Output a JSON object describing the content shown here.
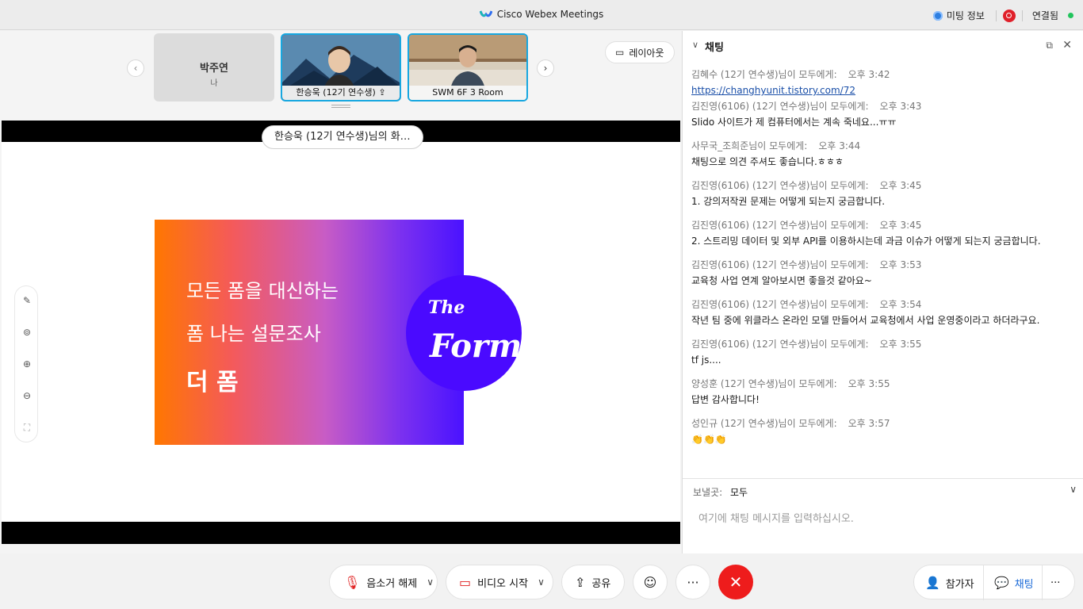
{
  "window": {
    "title": "Cisco Webex Meetings",
    "meeting_info": "미팅 정보",
    "connected": "연결됨"
  },
  "filmstrip": {
    "self_name": "박주연",
    "self_tag": "나",
    "participants": [
      {
        "label": "한승욱 (12기 연수생)"
      },
      {
        "label": "SWM 6F 3 Room"
      }
    ],
    "layout_label": "레이아웃"
  },
  "stage": {
    "share_label": "한승욱 (12기 연수생)님의 화…",
    "slide_line1": "모든 폼을 대신하는",
    "slide_line2": "폼 나는 설문조사",
    "slide_line3": "더 폼",
    "logo_the": "The",
    "logo_form": "Form"
  },
  "chat": {
    "title": "채팅",
    "messages": [
      {
        "from": "김혜수 (12기 연수생)님이 모두에게:",
        "time": "오후 3:42",
        "text": "https://changhyunit.tistory.com/72",
        "link": true
      },
      {
        "from": "김진영(6106) (12기 연수생)님이 모두에게:",
        "time": "오후 3:43",
        "text": "Slido 사이트가 제 컴퓨터에서는 계속 죽네요...ㅠㅠ"
      },
      {
        "from": "사무국_조희준님이 모두에게:",
        "time": "오후 3:44",
        "text": "채팅으로 의견 주셔도 좋습니다.ㅎㅎㅎ"
      },
      {
        "from": "김진영(6106) (12기 연수생)님이 모두에게:",
        "time": "오후 3:45",
        "text": "1. 강의저작권 문제는 어떻게 되는지 궁금합니다."
      },
      {
        "from": "김진영(6106) (12기 연수생)님이 모두에게:",
        "time": "오후 3:45",
        "text": "2. 스트리밍 데이터 및 외부 API를 이용하시는데 과금 이슈가 어떻게 되는지 궁금합니다."
      },
      {
        "from": "김진영(6106) (12기 연수생)님이 모두에게:",
        "time": "오후 3:53",
        "text": "교육청 사업 연계 알아보시면 좋을것 같아요~"
      },
      {
        "from": "김진영(6106) (12기 연수생)님이 모두에게:",
        "time": "오후 3:54",
        "text": "작년 팀 중에 위클라스 온라인 모델 만들어서 교육청에서 사업 운영중이라고 하더라구요."
      },
      {
        "from": "김진영(6106) (12기 연수생)님이 모두에게:",
        "time": "오후 3:55",
        "text": "tf js...."
      },
      {
        "from": "양성훈 (12기 연수생)님이 모두에게:",
        "time": "오후 3:55",
        "text": "답변 감사합니다!"
      },
      {
        "from": "성인규 (12기 연수생)님이 모두에게:",
        "time": "오후 3:57",
        "text": "👏👏👏"
      }
    ],
    "send_to_label": "보낼곳:",
    "send_to_value": "모두",
    "input_placeholder": "여기에 채팅 메시지를 입력하십시오."
  },
  "controls": {
    "unmute": "음소거 해제",
    "start_video": "비디오 시작",
    "share": "공유",
    "participants": "참가자",
    "chat": "채팅"
  },
  "colors": {
    "accent_blue": "#1a6ad8",
    "end_red": "#ee1c1c",
    "active_tile_border": "#17a7e0"
  }
}
